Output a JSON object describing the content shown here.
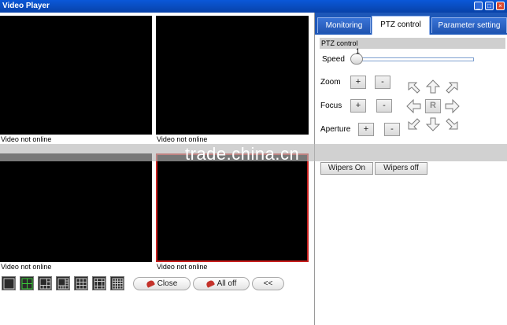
{
  "window": {
    "title": "Video Player",
    "minimize_glyph": "_",
    "maximize_glyph": "□",
    "close_glyph": "×"
  },
  "videos": [
    {
      "label": "Video not online"
    },
    {
      "label": "Video not online"
    },
    {
      "label": "Video not online"
    },
    {
      "label": "Video not online"
    }
  ],
  "watermark": "trade.china.cn",
  "bottom_bar": {
    "layout_icons": [
      "layout-1-icon",
      "layout-4-icon",
      "layout-6-icon",
      "layout-8-icon",
      "layout-9-icon",
      "layout-13-icon",
      "layout-16-icon"
    ],
    "close_label": "Close",
    "all_off_label": "All off",
    "collapse_label": "<<"
  },
  "tabs": [
    {
      "label": "Monitoring"
    },
    {
      "label": "PTZ control"
    },
    {
      "label": "Parameter setting"
    }
  ],
  "ptz": {
    "section_title": "PTZ control",
    "speed_label": "Speed",
    "speed_value": "1",
    "zoom_label": "Zoom",
    "focus_label": "Focus",
    "aperture_label": "Aperture",
    "plus": "+",
    "minus": "-",
    "center_label": "R",
    "wipers_on_label": "Wipers On",
    "wipers_off_label": "Wipers off"
  },
  "colors": {
    "titlebar": "#0a58d8",
    "tab_bar": "#1d57b8",
    "active_video_border": "#c8201e"
  }
}
